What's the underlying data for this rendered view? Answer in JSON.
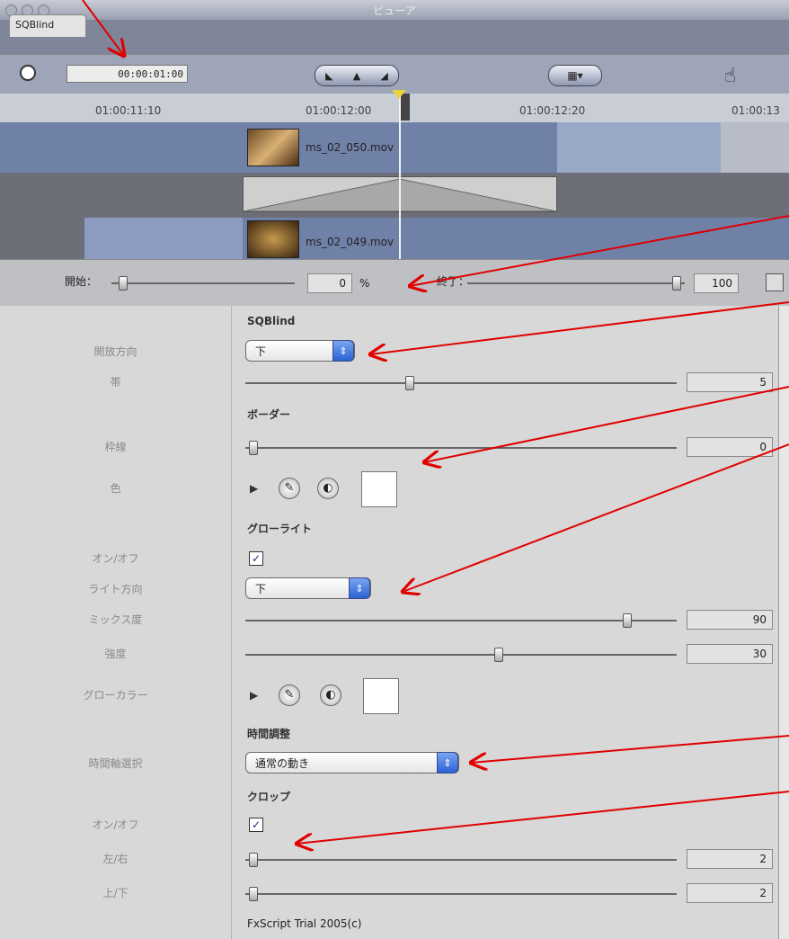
{
  "window": {
    "title": "ビューア",
    "tab": "SQBlind"
  },
  "toolbar": {
    "timecode": "00:00:01:00",
    "hand_icon": "hand-cursor-icon"
  },
  "ruler": {
    "labels": [
      "01:00:11:10",
      "01:00:12:00",
      "01:00:12:20",
      "01:00:13"
    ]
  },
  "tracks": {
    "clip_a": "ms_02_050.mov",
    "clip_b": "ms_02_049.mov"
  },
  "range": {
    "start_label": "開始：",
    "start_value": "0",
    "percent": "%",
    "end_label": "終了：",
    "end_value": "100"
  },
  "params": {
    "filter_name": "SQBlind",
    "open_dir_label": "開放方向",
    "open_dir_value": "下",
    "band_label": "帯",
    "band_value": "5",
    "border_section": "ボーダー",
    "frame_label": "枠線",
    "frame_value": "0",
    "color_label": "色",
    "glow_section": "グローライト",
    "glow_onoff_label": "オン/オフ",
    "light_dir_label": "ライト方向",
    "light_dir_value": "下",
    "mix_label": "ミックス度",
    "mix_value": "90",
    "intensity_label": "強度",
    "intensity_value": "30",
    "glow_color_label": "グローカラー",
    "time_section": "時間調整",
    "time_axis_label": "時間軸選択",
    "time_axis_value": "通常の動き",
    "crop_section": "クロップ",
    "crop_onoff_label": "オン/オフ",
    "lr_label": "左/右",
    "lr_value": "2",
    "tb_label": "上/下",
    "tb_value": "2",
    "credit": "FxScript Trial 2005(c)",
    "checkmark": "✓"
  },
  "colors": {
    "annotation_arrow": "#e00000",
    "popup_accent": "#2a62d6"
  }
}
